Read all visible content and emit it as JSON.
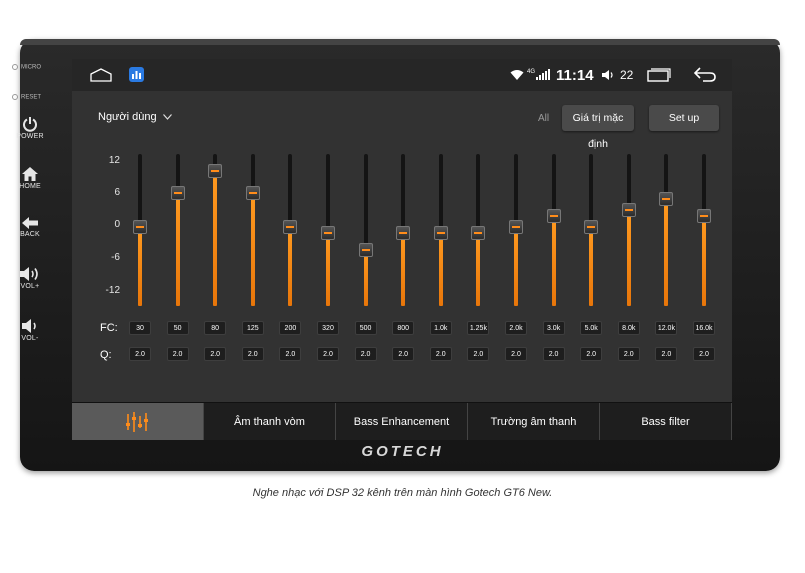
{
  "side": {
    "micro": "MICRO",
    "reset": "RESET",
    "power": "POWER",
    "home": "HOME",
    "back": "BACK",
    "vol_up": "VOL+",
    "vol_down": "VOL-"
  },
  "status": {
    "time": "11:14",
    "volume": "22",
    "network": "4G"
  },
  "toolbar": {
    "preset": "Người dùng",
    "all": "All",
    "default_btn": "Giá trị mặc định",
    "setup_btn": "Set up"
  },
  "eq": {
    "y_labels": [
      "12",
      "6",
      "0",
      "-6",
      "-12"
    ],
    "y_range": [
      -12,
      12
    ],
    "fc_label": "FC:",
    "q_label": "Q:",
    "bands": [
      {
        "fc": "30",
        "q": "2.0",
        "gain": 0.5
      },
      {
        "fc": "50",
        "q": "2.0",
        "gain": 6.5
      },
      {
        "fc": "80",
        "q": "2.0",
        "gain": 10.5
      },
      {
        "fc": "125",
        "q": "2.0",
        "gain": 6.5
      },
      {
        "fc": "200",
        "q": "2.0",
        "gain": 0.5
      },
      {
        "fc": "320",
        "q": "2.0",
        "gain": -0.5
      },
      {
        "fc": "500",
        "q": "2.0",
        "gain": -3.5
      },
      {
        "fc": "800",
        "q": "2.0",
        "gain": -0.5
      },
      {
        "fc": "1.0k",
        "q": "2.0",
        "gain": -0.5
      },
      {
        "fc": "1.25k",
        "q": "2.0",
        "gain": -0.5
      },
      {
        "fc": "2.0k",
        "q": "2.0",
        "gain": 0.5
      },
      {
        "fc": "3.0k",
        "q": "2.0",
        "gain": 2.5
      },
      {
        "fc": "5.0k",
        "q": "2.0",
        "gain": 0.5
      },
      {
        "fc": "8.0k",
        "q": "2.0",
        "gain": 3.5
      },
      {
        "fc": "12.0k",
        "q": "2.0",
        "gain": 5.5
      },
      {
        "fc": "16.0k",
        "q": "2.0",
        "gain": 2.5
      }
    ]
  },
  "tabs": [
    "",
    "Âm thanh vòm",
    "Bass Enhancement",
    "Trường âm thanh",
    "Bass filter"
  ],
  "brand": "GOTECH",
  "caption": "Nghe nhạc với DSP 32 kênh trên màn hình Gotech GT6 New.",
  "colors": {
    "accent": "#ff8c1a",
    "screen": "#323232"
  }
}
